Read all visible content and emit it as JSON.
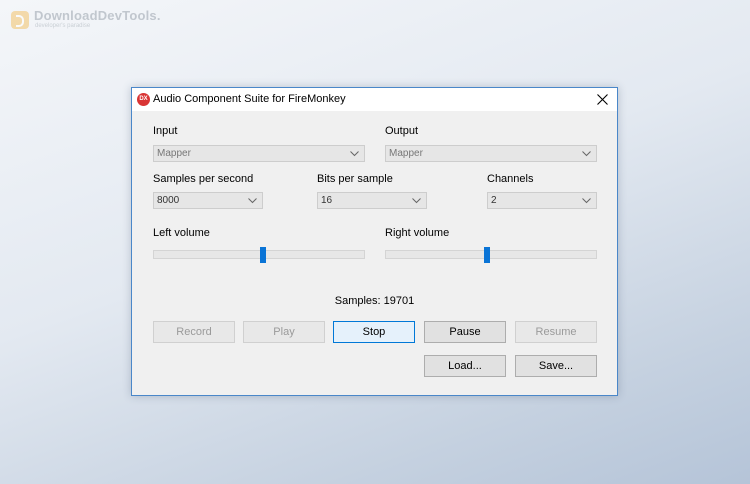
{
  "watermark": {
    "title": "DownloadDevTools.",
    "subtitle": "developer's paradise"
  },
  "window": {
    "title": "Audio Component Suite for FireMonkey",
    "icon_text": "DX",
    "icon": "app-icon",
    "close_icon": "close-icon"
  },
  "input": {
    "label": "Input",
    "value": "Mapper"
  },
  "output": {
    "label": "Output",
    "value": "Mapper"
  },
  "samples_per_second": {
    "label": "Samples per second",
    "value": "8000"
  },
  "bits_per_sample": {
    "label": "Bits per sample",
    "value": "16"
  },
  "channels": {
    "label": "Channels",
    "value": "2"
  },
  "left_volume": {
    "label": "Left volume",
    "level": 0.52
  },
  "right_volume": {
    "label": "Right volume",
    "level": 0.48
  },
  "status": {
    "samples_text": "Samples: 19701"
  },
  "buttons": {
    "record": "Record",
    "play": "Play",
    "stop": "Stop",
    "pause": "Pause",
    "resume": "Resume",
    "load": "Load...",
    "save": "Save..."
  },
  "colors": {
    "accent": "#0a74d6",
    "window_border": "#4a87c9"
  }
}
